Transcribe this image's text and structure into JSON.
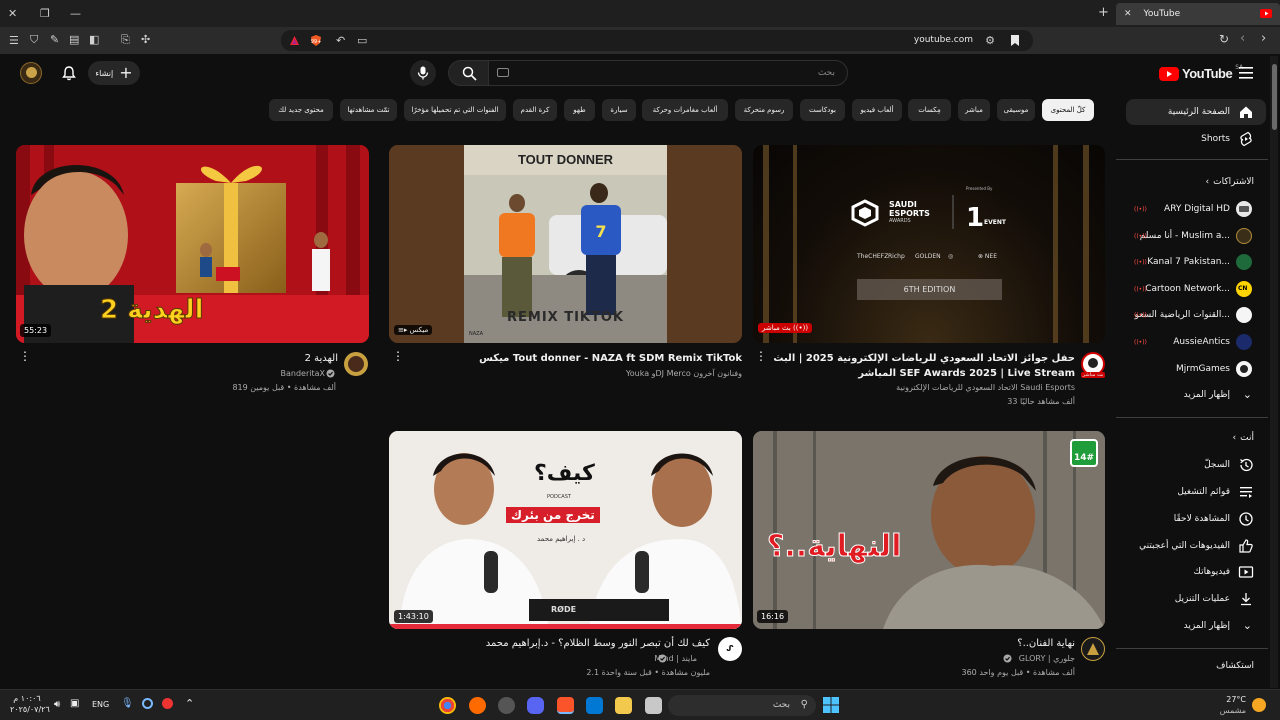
{
  "browser": {
    "tab_title": "YouTube",
    "url": "youtube.com",
    "accent_color": "#ff0000"
  },
  "header": {
    "logo_text": "YouTube",
    "region": "SA",
    "search_placeholder": "بحث",
    "create_label": "إنشاء"
  },
  "chips": [
    {
      "label": "كلّ المحتوى",
      "active": true
    },
    {
      "label": "موسيقى"
    },
    {
      "label": "مباشر"
    },
    {
      "label": "مِكسات"
    },
    {
      "label": "ألعاب فيديو"
    },
    {
      "label": "بودكاست"
    },
    {
      "label": "رسوم متحركة"
    },
    {
      "label": "ألعاب مغامرات وحركة"
    },
    {
      "label": "سيارة"
    },
    {
      "label": "طهو"
    },
    {
      "label": "كرة القدم"
    },
    {
      "label": "الفنوات التي تم تحميلها مؤخرًا"
    },
    {
      "label": "تمّت مشاهدتها"
    },
    {
      "label": "محتوى جديد لك"
    }
  ],
  "videos": [
    {
      "title": "حفل جوائز الاتحاد السعودي للرياضات الإلكترونية 2025 | البث المباشر SEF Awards 2025 | Live Stream",
      "channel": "الاتحاد السعودي للرياضات الإلكترونية Saudi Esports",
      "stats": "33 ألف مشاهد حاليًا",
      "badge": "بث مباشر",
      "avatar_badge": "بث مباشر",
      "thumb_text": [
        "SAUDI",
        "ESPORTS",
        "AWARDS",
        "Presented By",
        "EVENT",
        "6TH EDITION"
      ]
    },
    {
      "title": "ميكس Tout donner - NAZA ft SDM Remix TikTok",
      "channel": "Youka وDJ Merco وفنانون آخرون",
      "badge": "ميكس",
      "thumb_text": [
        "TOUT DONNER",
        "REMIX TIKTOK",
        "NAZA"
      ]
    },
    {
      "title": "الهدية 2",
      "channel": "BanderitaX",
      "stats": "819 ألف مشاهدة • قبل يومين",
      "duration": "55:23",
      "thumb_text": [
        "الهدية 2"
      ]
    },
    {
      "title": "نهاية الفنان..؟",
      "channel": "GLORY | جلوري",
      "stats": "360 ألف مشاهدة • قبل يوم واحد",
      "duration": "16:16",
      "thumb_text": [
        "النهاية..؟",
        "14#"
      ]
    },
    {
      "title": "كيف لك أن تبصر النور وسط الظلام؟ - د.إبراهيم محمد",
      "channel": "Mind | مايند",
      "stats": "2.1 مليون مشاهدة • قبل سنة واحدة",
      "duration": "1:43:10",
      "thumb_text": [
        "كيف؟",
        "PODCAST",
        "تخرج من بئرك",
        "د . إبراهيم محمد",
        "RØDE"
      ]
    }
  ],
  "sidebar": {
    "home": "الصفحة الرئيسية",
    "shorts": "Shorts",
    "subscriptions_header": "الاشتراكات",
    "subscriptions": [
      {
        "name": "ARY Digital HD"
      },
      {
        "name": "أنا مسلم - Muslim a..."
      },
      {
        "name": "Kanal 7 Pakistan..."
      },
      {
        "name": "Cartoon Network..."
      },
      {
        "name": "القنوات الرياضية السعو..."
      },
      {
        "name": "AussieAntics"
      },
      {
        "name": "MjrmGames"
      }
    ],
    "show_more_1": "إظهار المزيد",
    "you_header": "أنت",
    "you_items": [
      {
        "label": "السجلّ",
        "icon": "history-icon"
      },
      {
        "label": "قوائم التشغيل",
        "icon": "playlists-icon"
      },
      {
        "label": "المشاهدة لاحقًا",
        "icon": "watch-later-icon"
      },
      {
        "label": "الفيديوهات التي أعجبتني",
        "icon": "like-icon"
      },
      {
        "label": "فيديوهاتك",
        "icon": "your-videos-icon"
      },
      {
        "label": "عمليات التنزيل",
        "icon": "download-icon"
      },
      {
        "label": "إظهار المزيد",
        "icon": "chevron-down-icon"
      }
    ],
    "explore_header": "استكشاف"
  },
  "taskbar": {
    "weather_temp": "27°C",
    "weather_desc": "مشمس",
    "search_placeholder": "بحث",
    "lang": "ENG",
    "time": "١٠:٠٦ م",
    "date": "٢٠٢٥/٠٧/٢٦"
  }
}
